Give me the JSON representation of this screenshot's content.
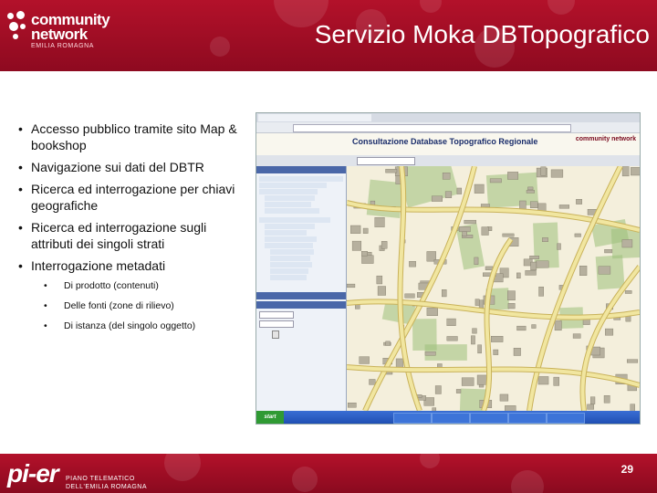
{
  "header": {
    "logo": {
      "line1": "community",
      "line2": "network",
      "line3": "EMILIA ROMAGNA"
    },
    "title": "Servizio Moka DBTopografico"
  },
  "bullets": [
    {
      "text": "Accesso pubblico tramite sito Map & bookshop"
    },
    {
      "text": "Navigazione sui dati del DBTR"
    },
    {
      "text": "Ricerca ed interrogazione per chiavi geografiche"
    },
    {
      "text": "Ricerca ed interrogazione sugli attributi dei singoli strati"
    },
    {
      "text": "Interrogazione metadati",
      "sub": [
        "Di prodotto (contenuti)",
        "Delle fonti (zone di rilievo)",
        "Di istanza (del singolo oggetto)"
      ]
    }
  ],
  "bullet_symbol": "•",
  "screenshot": {
    "app_title": "Consultazione Database Topografico Regionale",
    "brand": "community network",
    "start": "start",
    "colors": {
      "street": "#f1e6a0",
      "building": "#b6b09e",
      "green": "#9cc07a",
      "road_edge": "#c9b25a"
    }
  },
  "footer": {
    "logo": {
      "mark": "pi-er",
      "line1": "PIANO TELEMATICO",
      "line2": "DELL'EMILIA ROMAGNA"
    },
    "page": "29"
  },
  "colors": {
    "accent": "#a50f27",
    "text": "#111111"
  }
}
